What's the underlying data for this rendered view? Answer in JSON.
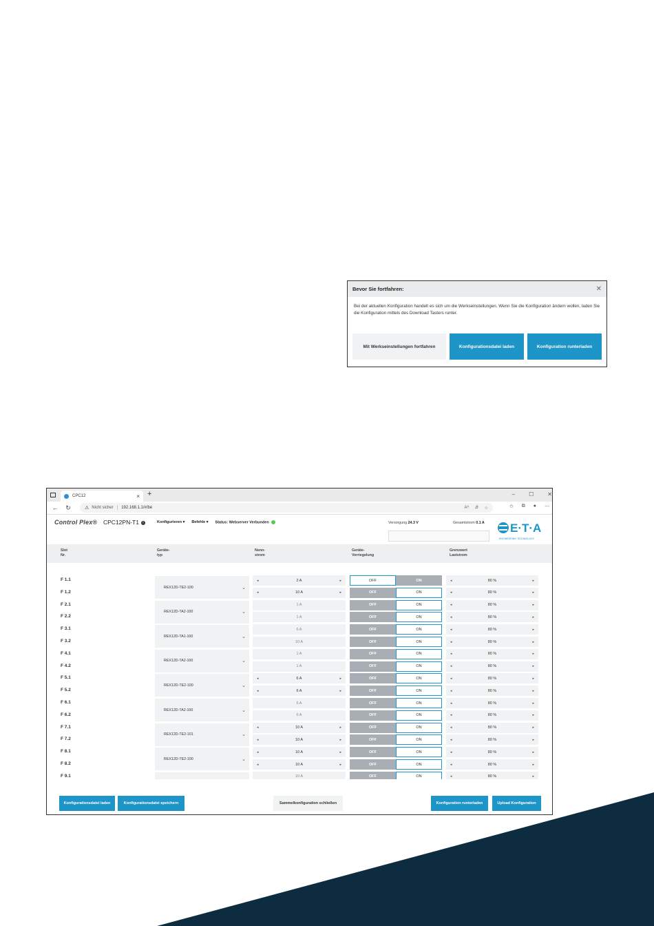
{
  "colors": {
    "primary_blue": "#1e95c9",
    "dark_navy": "#0d2c3f",
    "light_grey": "#f1f2f3",
    "toggle_grey": "#a9aeb4",
    "status_green": "#5ac85a"
  },
  "dialog": {
    "title": "Bevor Sie fortfahren:",
    "body": "Bei der aktuellen Konfiguration handelt es sich um die Werkseinstellungen. Wenn Sie die Konfiguration ändern wollen, laden Sie die Konfiguration mittels des Download Tasters runter.",
    "buttons": {
      "factory": "Mit Werkseinstellungen fortfahren",
      "load": "Konfigurationsdatei laden",
      "download": "Konfiguration runterladen"
    }
  },
  "browser": {
    "tab_title": "CPC12",
    "not_secure": "Nicht sicher",
    "url": "192.168.1.1/#/be",
    "win_minimize": "–",
    "win_maximize": "☐",
    "win_close": "✕"
  },
  "app": {
    "logo": "Control Plex®",
    "device": "CPC12PN-T1",
    "menu_configure": "Konfigurieren ▾",
    "menu_commands": "Befehle ▾",
    "status": "Status: Webserver Verbunden",
    "supply_label": "Versorgung",
    "supply_value": "24.3 V",
    "current_label": "Gesamtstrom",
    "current_value": "0.1 A",
    "brand": "E·T·A",
    "brand_sub": "ENGINEERING TECHNOLOGY"
  },
  "table": {
    "headers": {
      "slot_1": "Slot",
      "slot_2": "Nr.",
      "type_1": "Geräte-",
      "type_2": "typ",
      "current_1": "Nenn-",
      "current_2": "strom",
      "lock_1": "Geräte-",
      "lock_2": "Verriegelung",
      "limit_1": "Grenzwert",
      "limit_2": "Laststrom"
    },
    "on_label": "ON",
    "off_label": "OFF",
    "rows": [
      {
        "slot": "F 1.1",
        "current": "2 A",
        "adjustable": true,
        "lock": "off",
        "limit": "80 %"
      },
      {
        "slot": "F 1.2",
        "current": "10 A",
        "adjustable": true,
        "lock": "on",
        "limit": "80 %"
      },
      {
        "slot": "F 2.1",
        "current": "1 A",
        "adjustable": false,
        "lock": "on",
        "limit": "80 %"
      },
      {
        "slot": "F 2.2",
        "current": "1 A",
        "adjustable": false,
        "lock": "on",
        "limit": "80 %"
      },
      {
        "slot": "F 3.1",
        "current": "6 A",
        "adjustable": false,
        "lock": "on",
        "limit": "80 %"
      },
      {
        "slot": "F 3.2",
        "current": "10 A",
        "adjustable": false,
        "lock": "on",
        "limit": "80 %"
      },
      {
        "slot": "F 4.1",
        "current": "1 A",
        "adjustable": false,
        "lock": "on",
        "limit": "80 %"
      },
      {
        "slot": "F 4.2",
        "current": "1 A",
        "adjustable": false,
        "lock": "on",
        "limit": "80 %"
      },
      {
        "slot": "F 5.1",
        "current": "6 A",
        "adjustable": true,
        "lock": "on",
        "limit": "80 %"
      },
      {
        "slot": "F 5.2",
        "current": "6 A",
        "adjustable": true,
        "lock": "on",
        "limit": "80 %"
      },
      {
        "slot": "F 6.1",
        "current": "6 A",
        "adjustable": false,
        "lock": "on",
        "limit": "80 %"
      },
      {
        "slot": "F 6.2",
        "current": "6 A",
        "adjustable": false,
        "lock": "on",
        "limit": "80 %"
      },
      {
        "slot": "F 7.1",
        "current": "10 A",
        "adjustable": true,
        "lock": "on",
        "limit": "80 %"
      },
      {
        "slot": "F 7.2",
        "current": "10 A",
        "adjustable": true,
        "lock": "on",
        "limit": "80 %"
      },
      {
        "slot": "F 8.1",
        "current": "10 A",
        "adjustable": true,
        "lock": "on",
        "limit": "80 %"
      },
      {
        "slot": "F 8.2",
        "current": "10 A",
        "adjustable": true,
        "lock": "on",
        "limit": "80 %"
      },
      {
        "slot": "F 9.1",
        "current": "10 A",
        "adjustable": false,
        "lock": "on",
        "limit": "80 %"
      }
    ],
    "device_types": [
      "REX12D-TE2-100",
      "REX12D-TA2-100",
      "REX12D-TA1-100",
      "REX12D-TA2-100",
      "REX12D-TE2-100",
      "REX12D-TA2-100",
      "REX12D-TE2-101",
      "REX12D-TE2-100",
      "REX12D-TE2-100"
    ]
  },
  "footer": {
    "load": "Konfigurationsdatei laden",
    "save": "Konfigurationsdatei speichern",
    "close": "Sammelkonfiguration schließen",
    "download": "Konfiguration runterladen",
    "upload": "Upload Konfiguration"
  }
}
